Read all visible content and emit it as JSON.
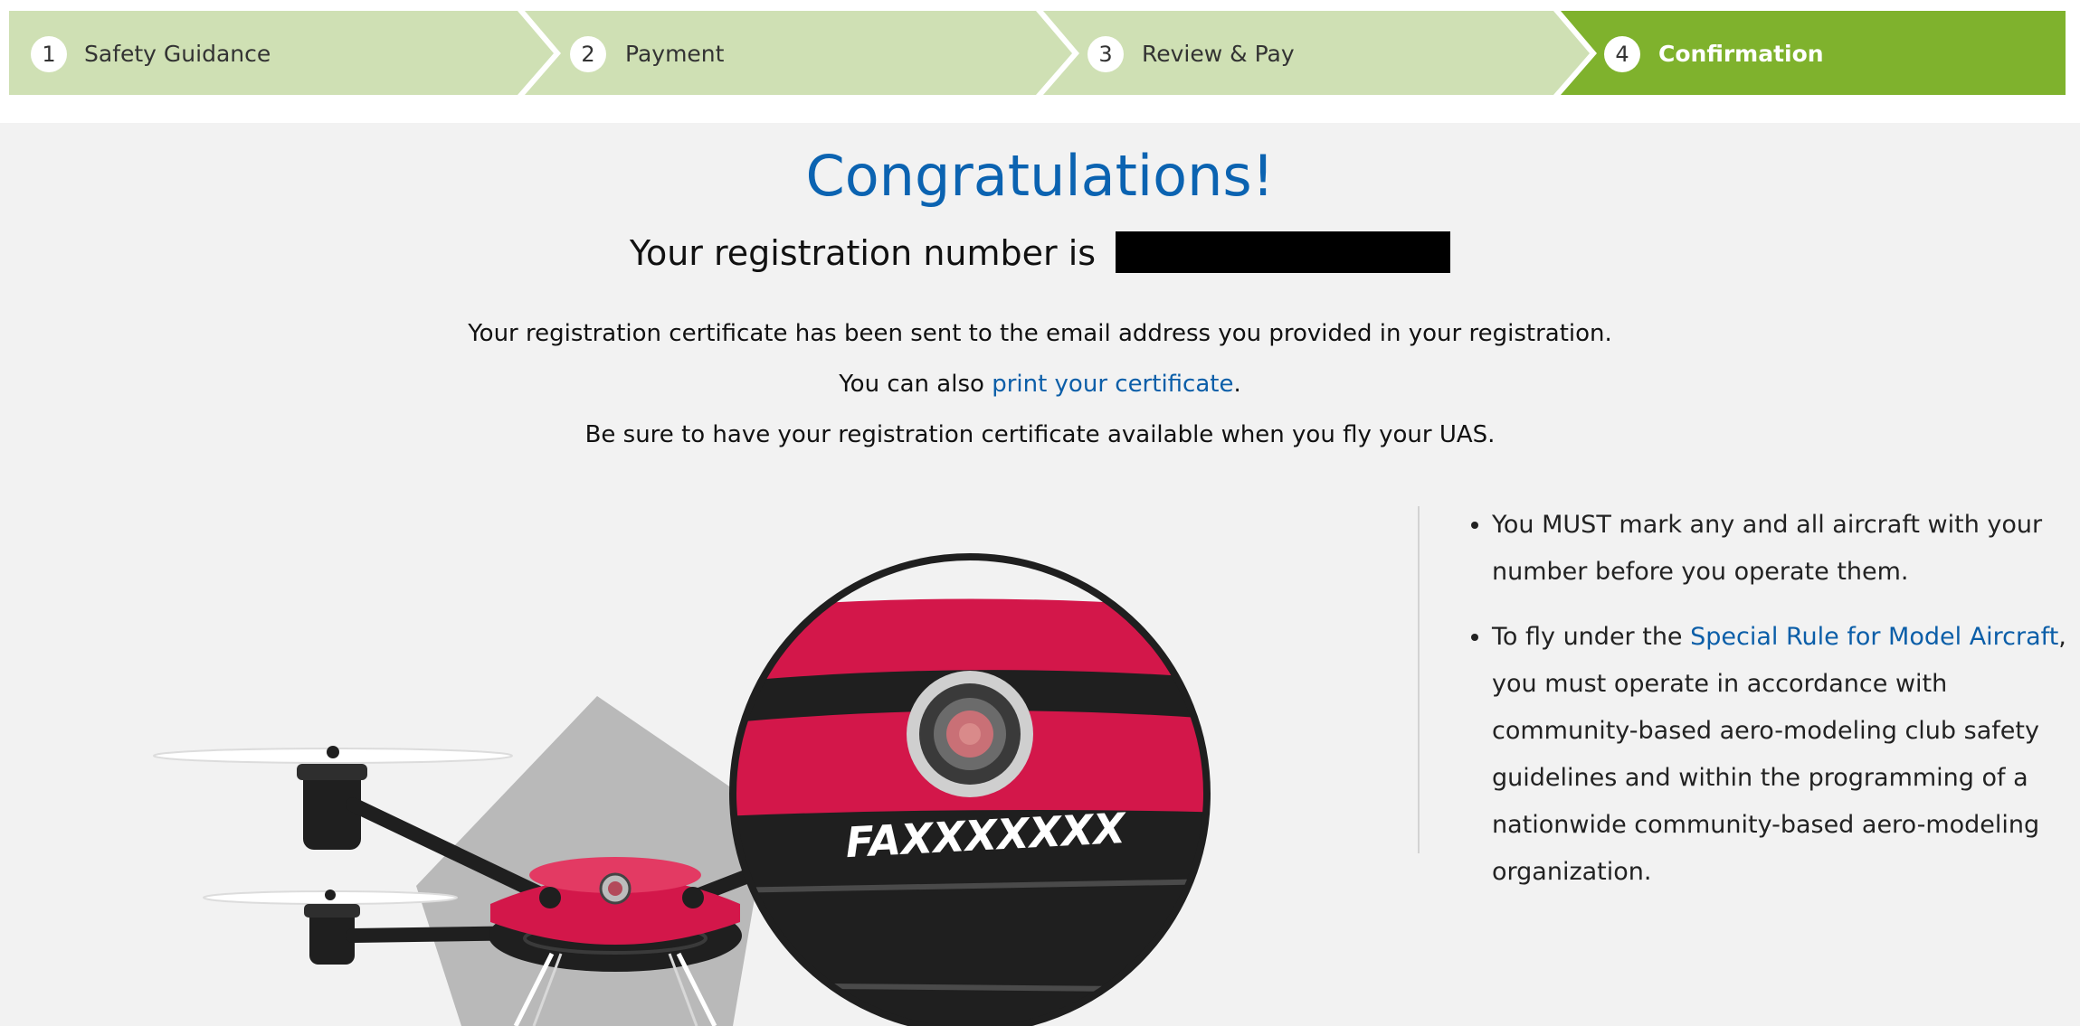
{
  "stepper": {
    "steps": [
      {
        "number": "1",
        "label": "Safety Guidance"
      },
      {
        "number": "2",
        "label": "Payment"
      },
      {
        "number": "3",
        "label": "Review & Pay"
      },
      {
        "number": "4",
        "label": "Confirmation"
      }
    ],
    "active_step": 4,
    "colors": {
      "inactive": "#cfe0b4",
      "active": "#7fb22d"
    }
  },
  "main": {
    "title": "Congratulations!",
    "registration_prefix": "Your registration number is",
    "certificate_sent": "Your registration certificate has been sent to the email address you provided in your registration.",
    "print_prefix": "You can also ",
    "print_link": "print your certificate",
    "print_suffix": ".",
    "reminder": "Be sure to have your registration certificate available when you fly your UAS."
  },
  "rules": {
    "item1": "You MUST mark any and all aircraft with your number before you operate them.",
    "item2_prefix": "To fly under the ",
    "item2_link": "Special Rule for Model Aircraft",
    "item2_suffix": ", you must operate in accordance with community-based aero-modeling club safety guidelines and within the programming of a nationwide community-based aero-modeling organization."
  },
  "illustration": {
    "marking_text": "FAXXXXXXX",
    "colors": {
      "drone_red": "#d3174a",
      "drone_black": "#1f1f1f"
    }
  }
}
